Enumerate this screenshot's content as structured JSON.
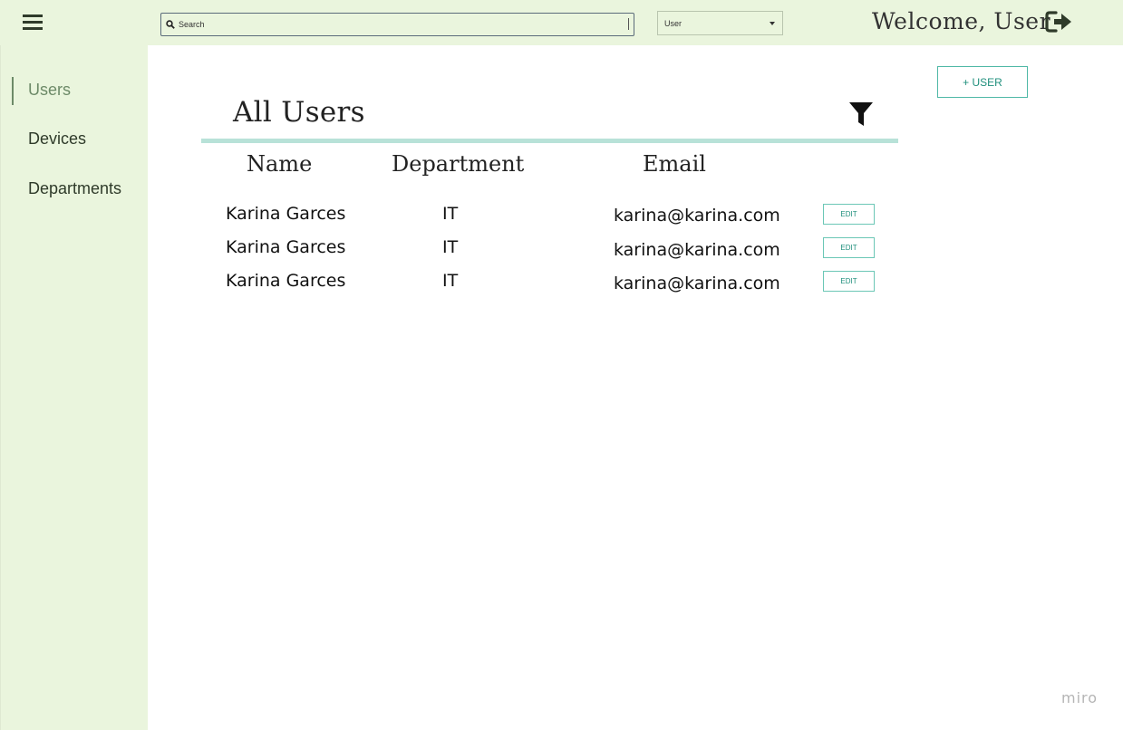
{
  "header": {
    "search_placeholder": "Search",
    "role_select": {
      "selected": "User"
    },
    "welcome_text": "Welcome, User"
  },
  "sidebar": {
    "items": [
      {
        "label": "Users",
        "active": true
      },
      {
        "label": "Devices",
        "active": false
      },
      {
        "label": "Departments",
        "active": false
      }
    ]
  },
  "main": {
    "title": "All Users",
    "add_user_label": "+ USER",
    "table": {
      "columns": [
        "Name",
        "Department",
        "Email"
      ],
      "rows": [
        {
          "name": "Karina Garces",
          "department": "IT",
          "email": "karina@karina.com",
          "action": "EDIT"
        },
        {
          "name": "Karina Garces",
          "department": "IT",
          "email": "karina@karina.com",
          "action": "EDIT"
        },
        {
          "name": "Karina Garces",
          "department": "IT",
          "email": "karina@karina.com",
          "action": "EDIT"
        }
      ]
    }
  },
  "watermark": "miro",
  "colors": {
    "panel_bg": "#eaf5dd",
    "accent": "#6cc7b6",
    "rule": "#b8e2d8",
    "active_nav": "#6d8a68"
  },
  "icons": [
    "hamburger-menu-icon",
    "search-icon",
    "chevron-down-icon",
    "logout-icon",
    "filter-icon"
  ]
}
